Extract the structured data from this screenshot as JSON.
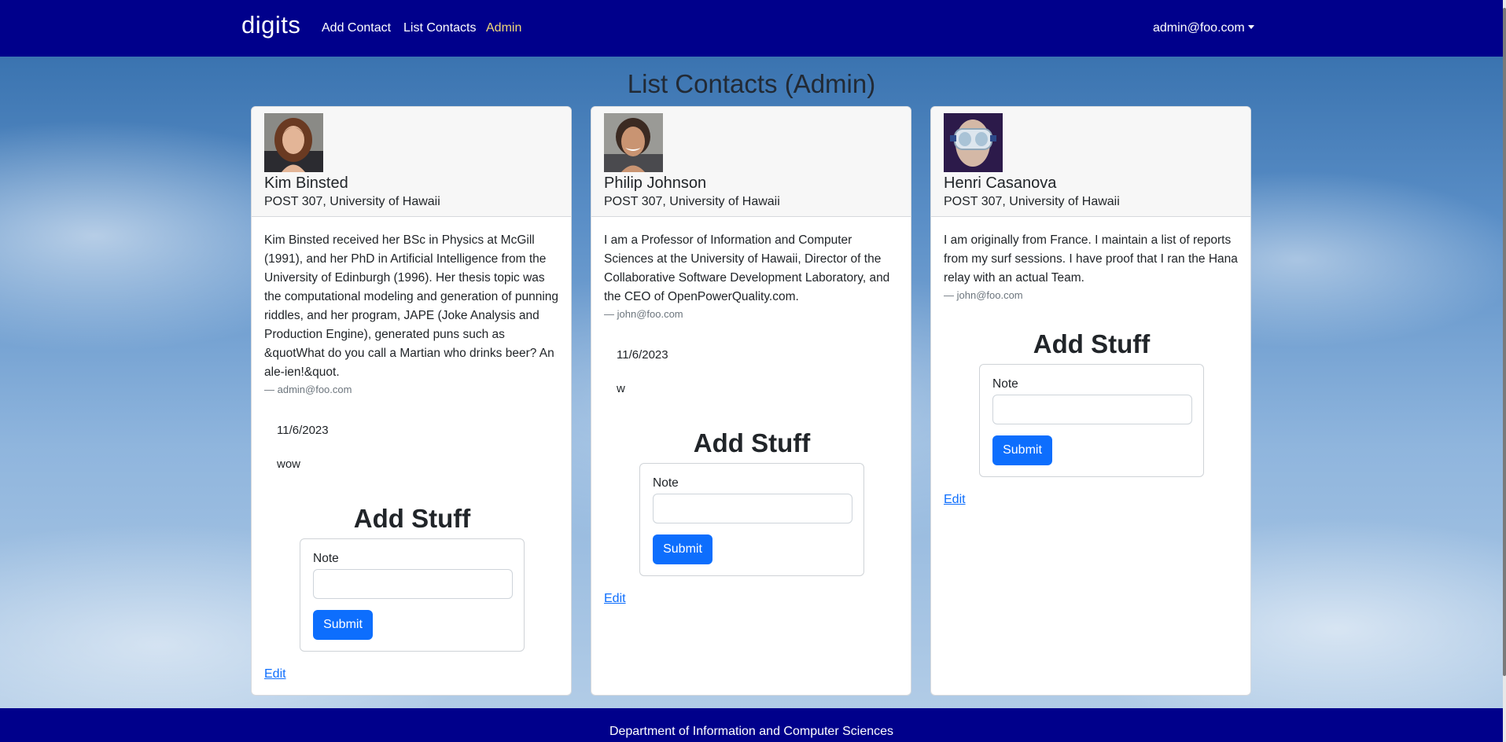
{
  "navbar": {
    "brand": "digits",
    "links": [
      {
        "label": "Add Contact"
      },
      {
        "label": "List Contacts"
      },
      {
        "label": "Admin"
      }
    ],
    "user": "admin@foo.com",
    "bg_color": "#00008b",
    "active_color": "#f0d878"
  },
  "page": {
    "title": "List Contacts (Admin)"
  },
  "contacts": [
    {
      "name": "Kim Binsted",
      "address": "POST 307, University of Hawaii",
      "avatar": "kim-binsted-photo",
      "description": "Kim Binsted received her BSc in Physics at McGill (1991), and her PhD in Artificial Intelligence from the University of Edinburgh (1996). Her thesis topic was the computational modeling and generation of punning riddles, and her program, JAPE (Joke Analysis and Production Engine), generated puns such as &quotWhat do you call a Martian who drinks beer? An ale-ien!&quot.",
      "owner": "— admin@foo.com",
      "notes": [
        {
          "date": "11/6/2023",
          "text": "wow"
        }
      ],
      "add_stuff": {
        "title": "Add Stuff",
        "label": "Note",
        "value": "",
        "submit": "Submit"
      },
      "edit": "Edit"
    },
    {
      "name": "Philip Johnson",
      "address": "POST 307, University of Hawaii",
      "avatar": "philip-johnson-photo",
      "description": "I am a Professor of Information and Computer Sciences at the University of Hawaii, Director of the Collaborative Software Development Laboratory, and the CEO of OpenPowerQuality.com.",
      "owner": "— john@foo.com",
      "notes": [
        {
          "date": "11/6/2023",
          "text": "w"
        }
      ],
      "add_stuff": {
        "title": "Add Stuff",
        "label": "Note",
        "value": "",
        "submit": "Submit"
      },
      "edit": "Edit"
    },
    {
      "name": "Henri Casanova",
      "address": "POST 307, University of Hawaii",
      "avatar": "henri-casanova-photo",
      "description": "I am originally from France. I maintain a list of reports from my surf sessions. I have proof that I ran the Hana relay with an actual Team.",
      "owner": "— john@foo.com",
      "notes": [],
      "add_stuff": {
        "title": "Add Stuff",
        "label": "Note",
        "value": "",
        "submit": "Submit"
      },
      "edit": "Edit"
    }
  ],
  "footer": {
    "text": "Department of Information and Computer Sciences"
  },
  "colors": {
    "primary_button": "#0d6efd",
    "link": "#0d6efd"
  }
}
